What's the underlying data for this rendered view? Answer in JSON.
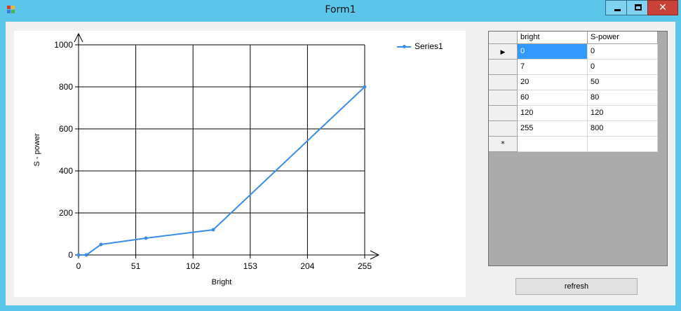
{
  "window": {
    "title": "Form1",
    "close_glyph": "✕",
    "icons": [
      "app-icon",
      "minimize-icon",
      "maximize-icon",
      "close-icon"
    ]
  },
  "chart_data": {
    "type": "line",
    "title": "",
    "xlabel": "Bright",
    "ylabel": "S - power",
    "xlim": [
      0,
      255
    ],
    "ylim": [
      0,
      1000
    ],
    "x_ticks": [
      "0",
      "51",
      "102",
      "153",
      "204",
      "255"
    ],
    "y_ticks": [
      "0",
      "200",
      "400",
      "600",
      "800",
      "1000"
    ],
    "grid": true,
    "legend": "top-right",
    "series": [
      {
        "name": "Series1",
        "color": "#3b8de8",
        "x": [
          0,
          7,
          20,
          60,
          120,
          255
        ],
        "y": [
          0,
          0,
          50,
          80,
          120,
          800
        ]
      }
    ]
  },
  "table": {
    "columns": [
      "bright",
      "S-power"
    ],
    "rows": [
      [
        "0",
        "0"
      ],
      [
        "7",
        "0"
      ],
      [
        "20",
        "50"
      ],
      [
        "60",
        "80"
      ],
      [
        "120",
        "120"
      ],
      [
        "255",
        "800"
      ]
    ],
    "current_row_glyph": "▶",
    "new_row_glyph": "*"
  },
  "refresh_button": {
    "label": "refresh"
  }
}
